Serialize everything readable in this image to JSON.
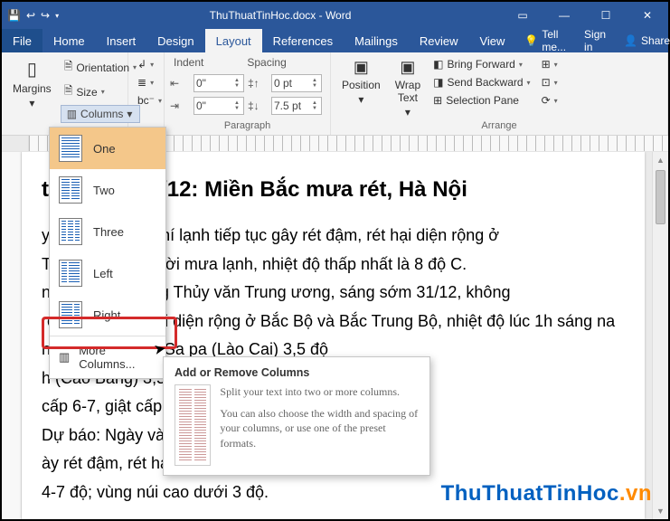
{
  "titlebar": {
    "doc_title": "ThuThuatTinHoc.docx - Word"
  },
  "tabs": {
    "file": "File",
    "home": "Home",
    "insert": "Insert",
    "design": "Design",
    "layout": "Layout",
    "references": "References",
    "mailings": "Mailings",
    "review": "Review",
    "view": "View",
    "tell": "Tell me...",
    "signin": "Sign in",
    "share": "Share"
  },
  "ribbon": {
    "margins": "Margins",
    "orientation": "Orientation",
    "size": "Size",
    "columns": "Columns",
    "indent_label": "Indent",
    "spacing_label": "Spacing",
    "indent_left": "0\"",
    "indent_right": "0\"",
    "spacing_before": "0 pt",
    "spacing_after": "7.5 pt",
    "paragraph": "Paragraph",
    "position": "Position",
    "wrap": "Wrap\nText",
    "bring_forward": "Bring Forward",
    "send_backward": "Send Backward",
    "selection_pane": "Selection Pane",
    "arrange": "Arrange"
  },
  "columns_menu": {
    "one": "One",
    "two": "Two",
    "three": "Three",
    "left": "Left",
    "right": "Right",
    "more": "More Columns..."
  },
  "tooltip": {
    "title": "Add or Remove Columns",
    "p1": "Split your text into two or more columns.",
    "p2": "You can also choose the width and spacing of your columns, or use one of the preset formats."
  },
  "document": {
    "heading": "tiết ngày 31/12: Miền Bắc mưa rét, Hà Nội",
    "p1": "y 31/12, không khí lạnh tiếp tục gây rét đậm, rét hại diện rộng ở",
    "p2": "Thủ đô Hà Nội, trời mưa lạnh, nhiệt độ thấp nhất là 8 độ C.",
    "p3": "ng tâm Khí tượng Thủy văn Trung ương, sáng sớm 31/12, không",
    "p4": "rét đậm và rét hại diện rộng ở Bắc Bộ và Bắc Trung Bộ, nhiệt độ lúc 1h sáng na",
    "p5": "ng Sơn) -0,6 độ; Sa pa (Lào Cai) 3,5 độ",
    "p6": "h (Cao Bằng) 3,5 độ, Hà Nội 10,0 độ,",
    "p7": "cấp 6-7, giật cấp 8.",
    "p8": "Dự báo: Ngày và",
    "p9": "ày rét đậm, rét hại diện rộng ở Bắc Bộ và",
    "p10": "4-7 độ; vùng núi cao dưới 3 độ."
  },
  "watermark": {
    "t1": "ThuThuatTinHoc",
    "t2": ".vn"
  }
}
